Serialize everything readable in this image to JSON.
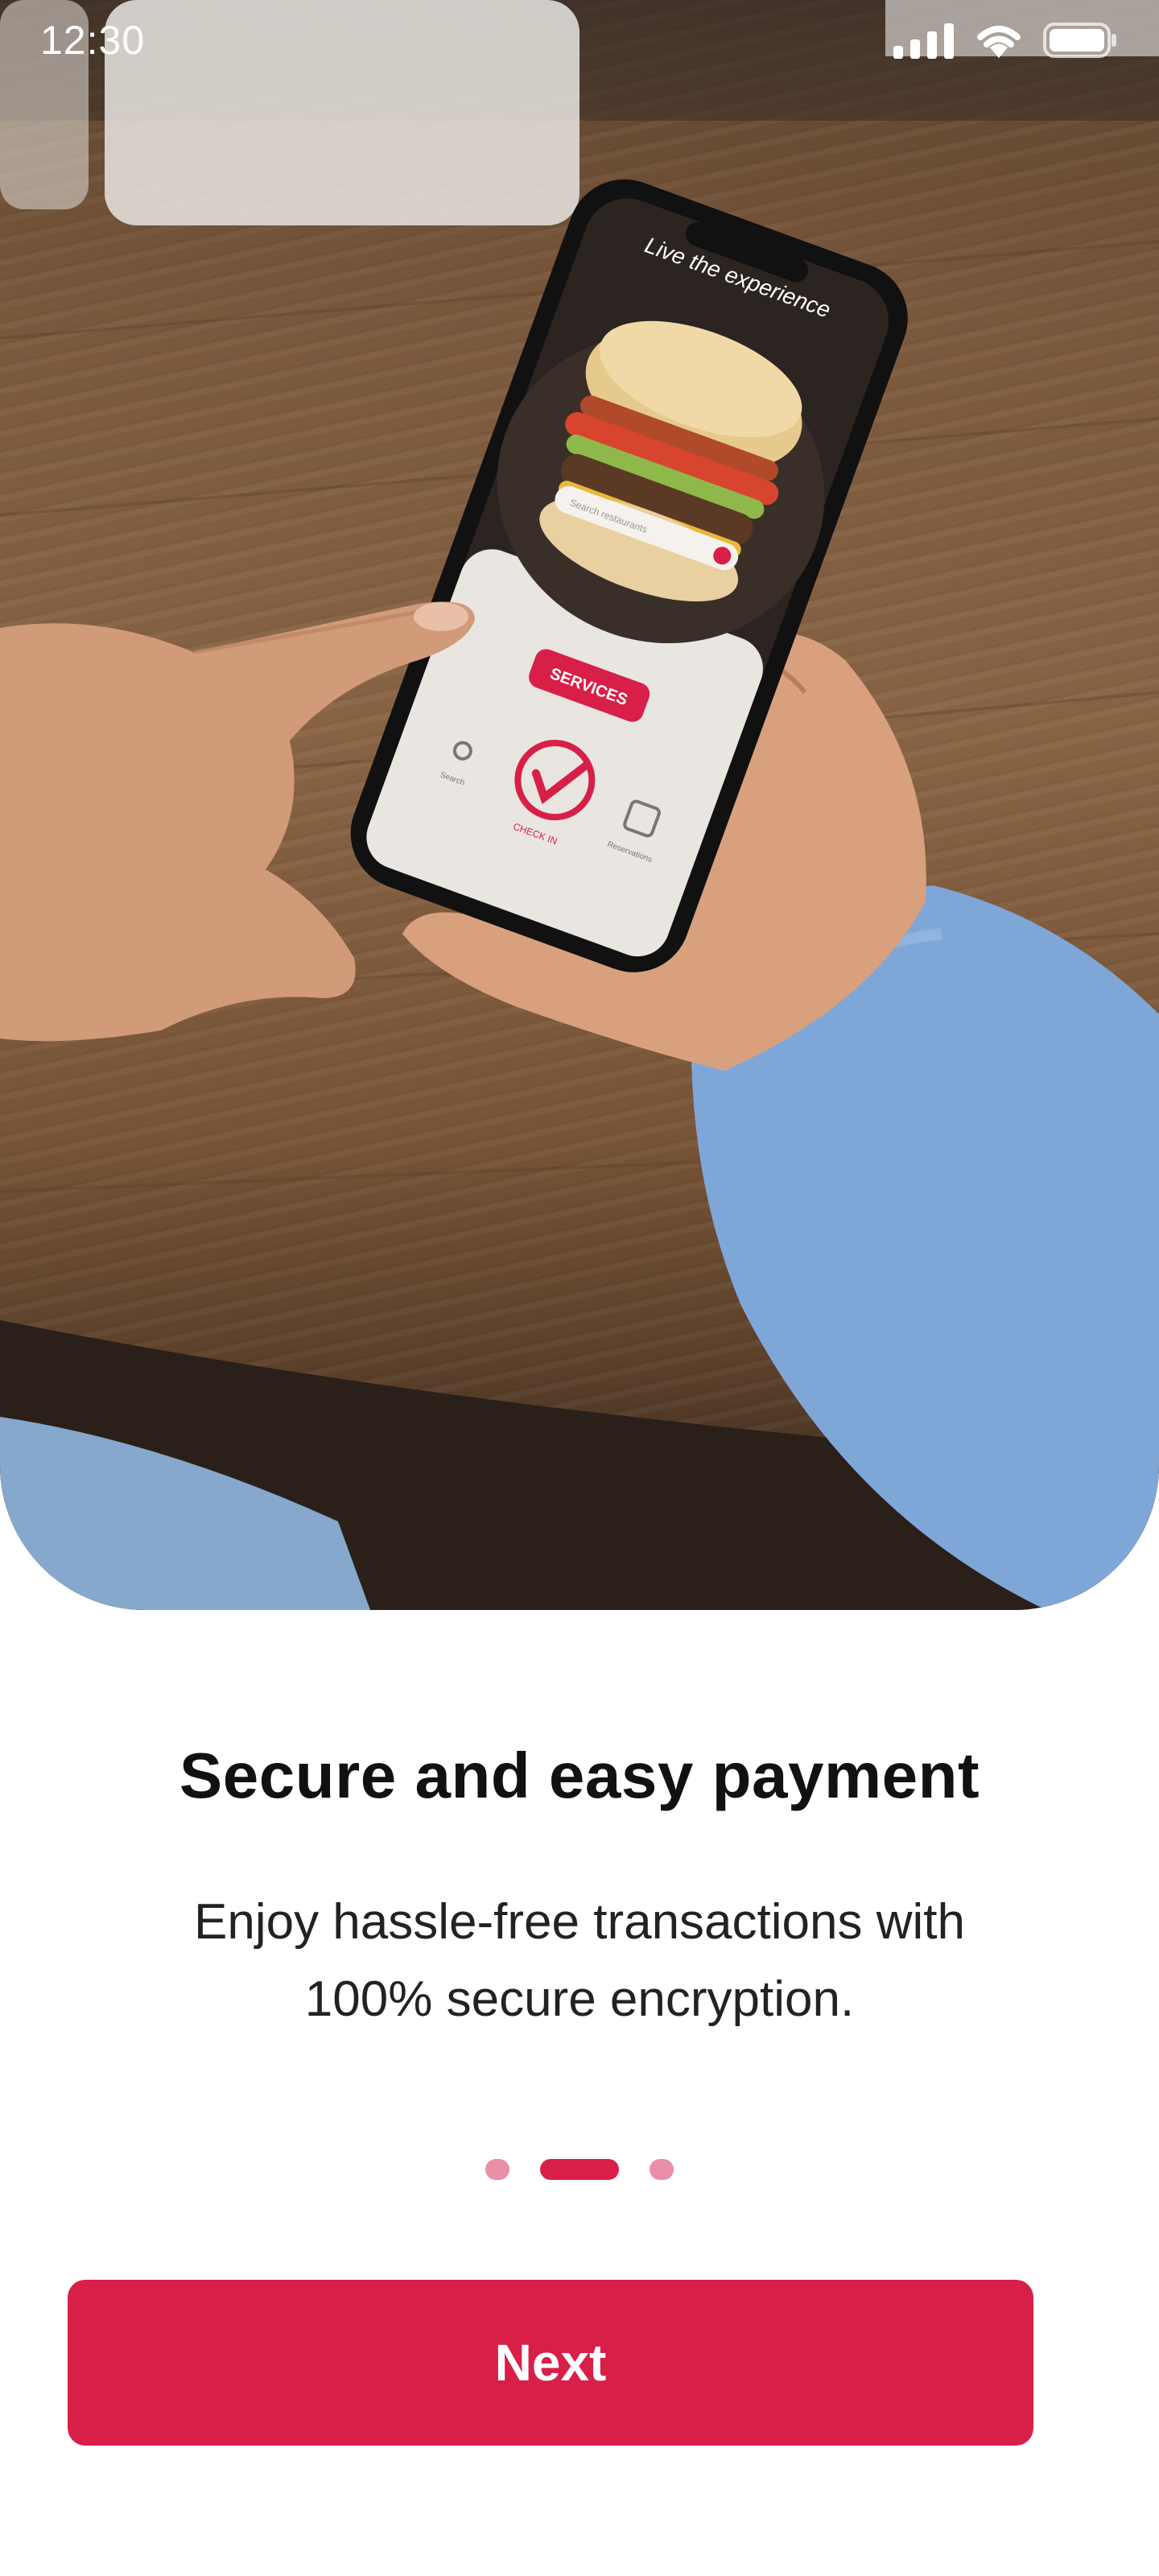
{
  "status_bar": {
    "time": "12:30"
  },
  "hero": {
    "image_alt": "Hands holding a smartphone showing a burger food app on a wooden table",
    "phone_screen": {
      "headline": "Live the experience",
      "search_placeholder": "Search restaurants",
      "services_label": "SERVICES",
      "checkin_label": "CHECK IN",
      "search_label": "Search",
      "reservations_label": "Reservations"
    }
  },
  "content": {
    "title": "Secure and easy payment",
    "subtitle": "Enjoy hassle-free transactions with 100% secure encryption."
  },
  "pager": {
    "total": 3,
    "active_index": 1
  },
  "next_button": {
    "label": "Next"
  },
  "colors": {
    "accent": "#d81f48",
    "dot_inactive": "#e88ea6"
  }
}
